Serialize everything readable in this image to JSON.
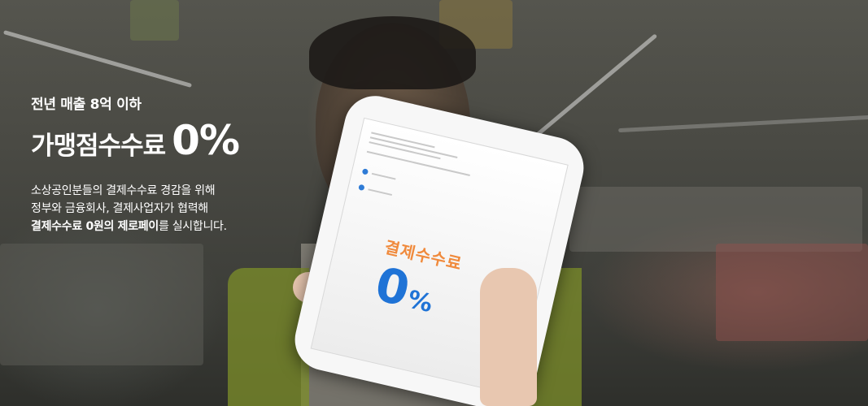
{
  "hero": {
    "subtitle": "전년 매출 8억 이하",
    "title_text": "가맹점수수료",
    "title_number": "0%",
    "description": [
      "소상공인분들의 결제수수료 경감을 위해",
      "정부와 금융회사, 결제사업자가 협력해"
    ],
    "description_bold": "결제수수료 0원의 제로페이",
    "description_tail": "를 실시합니다."
  },
  "phone_screen": {
    "fee_label": "결제수수료",
    "fee_number": "0",
    "fee_unit": "%"
  },
  "colors": {
    "accent_blue": "#1f73d6",
    "accent_orange": "#f08a3c",
    "text_white": "#ffffff"
  }
}
